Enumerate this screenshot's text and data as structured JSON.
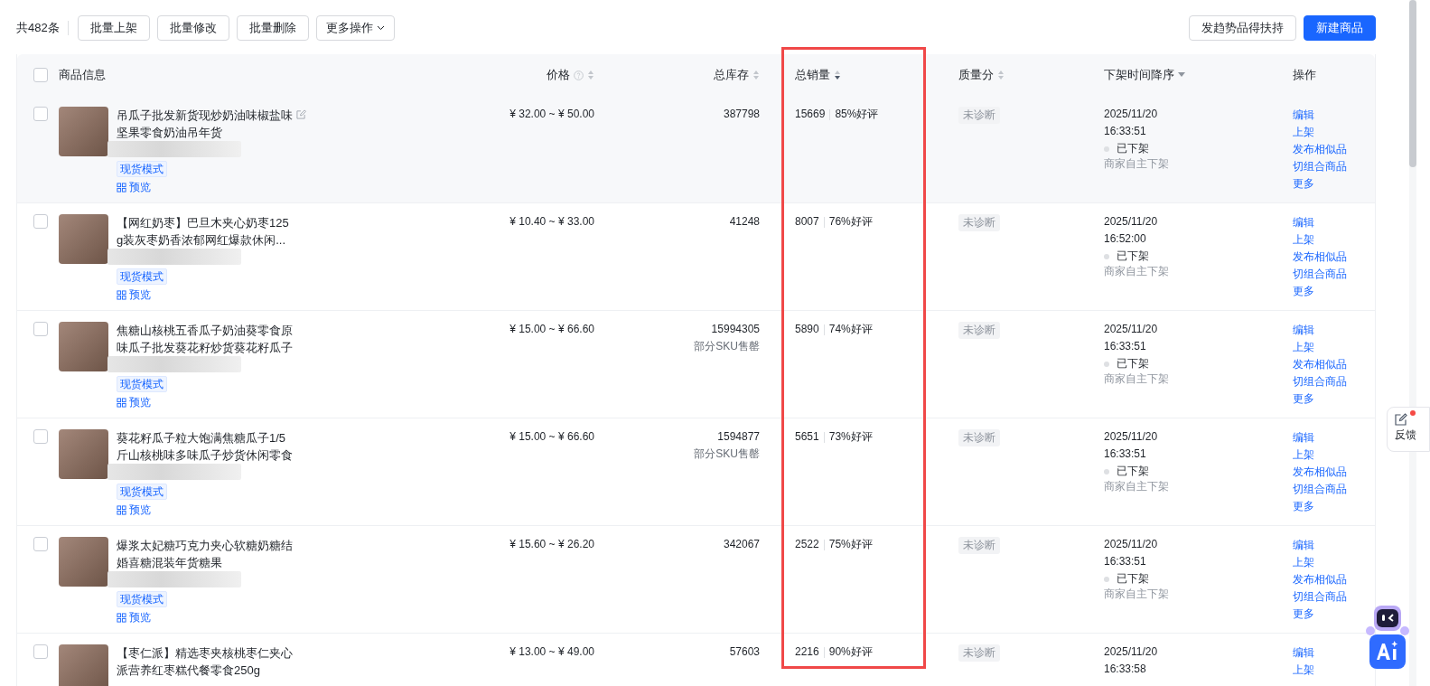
{
  "toolbar": {
    "count": "共482条",
    "buttons": [
      {
        "label": "批量上架",
        "dropdown": false
      },
      {
        "label": "批量修改",
        "dropdown": false
      },
      {
        "label": "批量删除",
        "dropdown": false
      },
      {
        "label": "更多操作",
        "dropdown": true
      }
    ],
    "right_buttons": [
      {
        "label": "发趋势品得扶持",
        "primary": false
      },
      {
        "label": "新建商品",
        "primary": true
      }
    ]
  },
  "table": {
    "select_all": {
      "checked": false
    },
    "columns": [
      {
        "kind": "product",
        "label": "商品信息",
        "sortable": false
      },
      {
        "kind": "price",
        "label": "价格",
        "sortable": true,
        "descending": false,
        "help": true
      },
      {
        "kind": "stock",
        "label": "总库存",
        "sortable": true,
        "descending": false
      },
      {
        "kind": "sales",
        "label": "总销量",
        "sortable": true,
        "descending": true
      },
      {
        "kind": "quality",
        "label": "质量分",
        "sortable": true,
        "descending": false
      },
      {
        "kind": "time",
        "label": "下架时间降序",
        "sortable": false,
        "dropdown": true
      },
      {
        "kind": "actions",
        "label": "操作",
        "sortable": false
      }
    ],
    "rows": [
      {
        "highlighted": true,
        "checked": false,
        "title_lines": [
          "吊瓜子批发新货现炒奶油味椒盐味",
          "坚果零食奶油吊年货"
        ],
        "editable": true,
        "blurred": true,
        "tag": "现货模式",
        "preview": "预览",
        "price": "¥ 32.00 ~ ¥ 50.00",
        "stock": "387798",
        "sales": "15669",
        "rating": "85%好评",
        "quality": "未诊断",
        "date": "2025/11/20",
        "time": "16:33:51",
        "status": "已下架",
        "reason": "商家自主下架",
        "actions": [
          "编辑",
          "上架",
          "发布相似品",
          "切组合商品",
          "更多"
        ]
      },
      {
        "highlighted": false,
        "checked": false,
        "title_lines": [
          "【网红奶枣】巴旦木夹心奶枣125",
          "g装灰枣奶香浓郁网红爆款休闲..."
        ],
        "editable": false,
        "blurred": true,
        "tag": "现货模式",
        "preview": "预览",
        "price": "¥ 10.40 ~ ¥ 33.00",
        "stock": "41248",
        "sales": "8007",
        "rating": "76%好评",
        "quality": "未诊断",
        "date": "2025/11/20",
        "time": "16:52:00",
        "status": "已下架",
        "reason": "商家自主下架",
        "actions": [
          "编辑",
          "上架",
          "发布相似品",
          "切组合商品",
          "更多"
        ]
      },
      {
        "highlighted": false,
        "checked": false,
        "title_lines": [
          "焦糖山核桃五香瓜子奶油葵零食原",
          "味瓜子批发葵花籽炒货葵花籽瓜子"
        ],
        "editable": false,
        "blurred": true,
        "tag": "现货模式",
        "preview": "预览",
        "price": "¥ 15.00 ~ ¥ 66.60",
        "stock": "15994305",
        "stock_note": "部分SKU售罄",
        "sales": "5890",
        "rating": "74%好评",
        "quality": "未诊断",
        "date": "2025/11/20",
        "time": "16:33:51",
        "status": "已下架",
        "reason": "商家自主下架",
        "actions": [
          "编辑",
          "上架",
          "发布相似品",
          "切组合商品",
          "更多"
        ]
      },
      {
        "highlighted": false,
        "checked": false,
        "title_lines": [
          "葵花籽瓜子粒大饱满焦糖瓜子1/5",
          "斤山核桃味多味瓜子炒货休闲零食"
        ],
        "editable": false,
        "blurred": true,
        "tag": "现货模式",
        "preview": "预览",
        "price": "¥ 15.00 ~ ¥ 66.60",
        "stock": "1594877",
        "stock_note": "部分SKU售罄",
        "sales": "5651",
        "rating": "73%好评",
        "quality": "未诊断",
        "date": "2025/11/20",
        "time": "16:33:51",
        "status": "已下架",
        "reason": "商家自主下架",
        "actions": [
          "编辑",
          "上架",
          "发布相似品",
          "切组合商品",
          "更多"
        ]
      },
      {
        "highlighted": false,
        "checked": false,
        "title_lines": [
          "爆浆太妃糖巧克力夹心软糖奶糖结",
          "婚喜糖混装年货糖果"
        ],
        "editable": false,
        "blurred": true,
        "tag": "现货模式",
        "preview": "预览",
        "price": "¥ 15.60 ~ ¥ 26.20",
        "stock": "342067",
        "sales": "2522",
        "rating": "75%好评",
        "quality": "未诊断",
        "date": "2025/11/20",
        "time": "16:33:51",
        "status": "已下架",
        "reason": "商家自主下架",
        "actions": [
          "编辑",
          "上架",
          "发布相似品",
          "切组合商品",
          "更多"
        ]
      },
      {
        "checked": false,
        "title_lines": [
          "【枣仁派】精选枣夹核桃枣仁夹心",
          "派营养红枣糕代餐零食250g"
        ],
        "price": "¥ 13.00 ~ ¥ 49.00",
        "stock": "57603",
        "sales": "2216",
        "rating": "90%好评",
        "quality": "未诊断",
        "date": "2025/11/20",
        "time": "16:33:58",
        "actions": [
          "编辑",
          "上架"
        ]
      }
    ]
  },
  "feedback": {
    "label": "反馈",
    "unread": true
  }
}
